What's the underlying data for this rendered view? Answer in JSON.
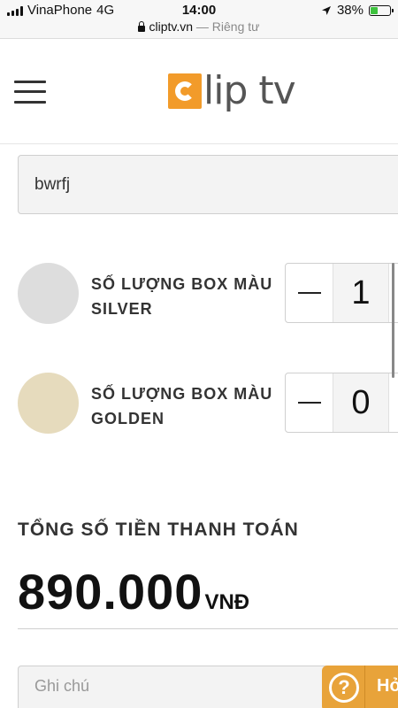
{
  "status_bar": {
    "carrier": "VinaPhone",
    "network": "4G",
    "time": "14:00",
    "battery": "38%",
    "battery_level": 0.38,
    "battery_color": "#3ec23e"
  },
  "browser": {
    "domain": "cliptv.vn",
    "privacy_label": "— Riêng tư"
  },
  "header": {
    "logo_text": "lip tv",
    "brand_color": "#f29b2a",
    "menu_icon": "hamburger-menu-icon"
  },
  "form": {
    "name_value": "bwrfj",
    "boxes": [
      {
        "label": "Số lượng box màu silver",
        "quantity": "1",
        "swatch_color": "#dddddd"
      },
      {
        "label": "Số lượng box màu golden",
        "quantity": "0",
        "swatch_color": "#e6dbbd"
      }
    ],
    "total_label": "Tổng số tiền thanh toán",
    "total_amount": "890.000",
    "currency": "VNĐ",
    "note_placeholder": "Ghi chú"
  },
  "help": {
    "icon": "question-icon",
    "label": "Hỏ"
  }
}
